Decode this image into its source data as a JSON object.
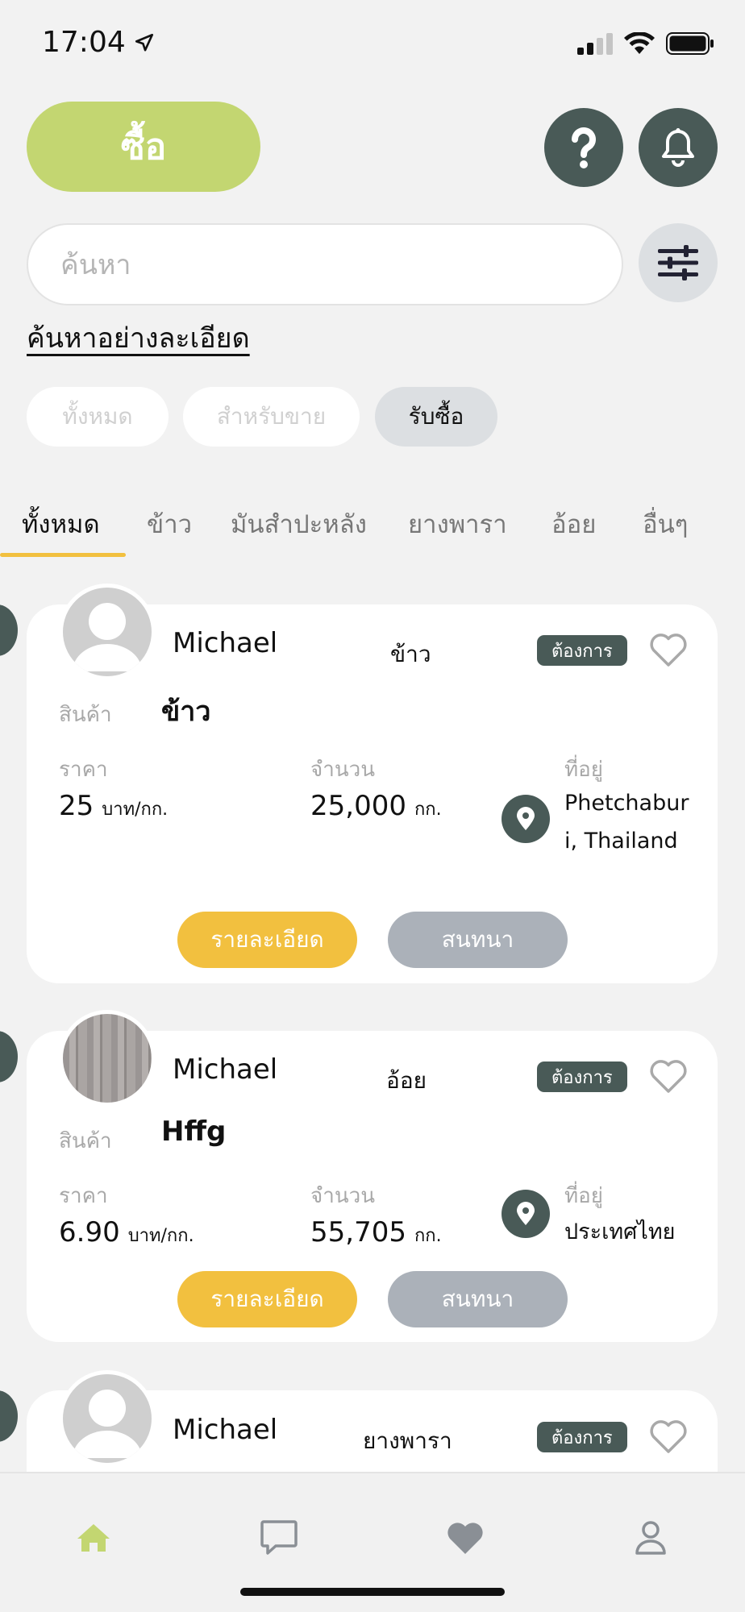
{
  "status_bar": {
    "time": "17:04"
  },
  "header": {
    "buy_label": "ซื้อ"
  },
  "search": {
    "placeholder": "ค้นหา",
    "advanced_label": "ค้นหาอย่างละเอียด"
  },
  "chips": [
    {
      "label": "ทั้งหมด",
      "active": false
    },
    {
      "label": "สำหรับขาย",
      "active": false
    },
    {
      "label": "รับซื้อ",
      "active": true
    }
  ],
  "tabs": [
    {
      "label": "ทั้งหมด",
      "active": true
    },
    {
      "label": "ข้าว",
      "active": false
    },
    {
      "label": "มันสำปะหลัง",
      "active": false
    },
    {
      "label": "ยางพารา",
      "active": false
    },
    {
      "label": "อ้อย",
      "active": false
    },
    {
      "label": "อื่นๆ",
      "active": false
    }
  ],
  "labels": {
    "product": "สินค้า",
    "price": "ราคา",
    "quantity": "จำนวน",
    "address": "ที่อยู่",
    "price_unit": "บาท/กก.",
    "qty_unit": "กก.",
    "details_button": "รายละเอียด",
    "chat_button": "สนทนา",
    "want_badge": "ต้องการ"
  },
  "listings": [
    {
      "user": "Michael",
      "category": "ข้าว",
      "product": "ข้าว",
      "price": "25",
      "quantity": "25,000",
      "address": "Phetchaburi, Thailand",
      "avatar": "default-avatar"
    },
    {
      "user": "Michael",
      "category": "อ้อย",
      "product": "Hffg",
      "price": "6.90",
      "quantity": "55,705",
      "address": "ประเทศไทย",
      "avatar": "photo-avatar"
    },
    {
      "user": "Michael",
      "category": "ยางพารา",
      "avatar": "default-avatar"
    }
  ],
  "bottom_nav": [
    {
      "icon": "home-icon",
      "active": true
    },
    {
      "icon": "chat-icon",
      "active": false
    },
    {
      "icon": "heart-icon",
      "active": false
    },
    {
      "icon": "profile-icon",
      "active": false
    }
  ],
  "colors": {
    "accent_green": "#c3d671",
    "dark_teal": "#495a57",
    "yellow": "#f2c03f",
    "gray_button": "#abb1b9"
  }
}
